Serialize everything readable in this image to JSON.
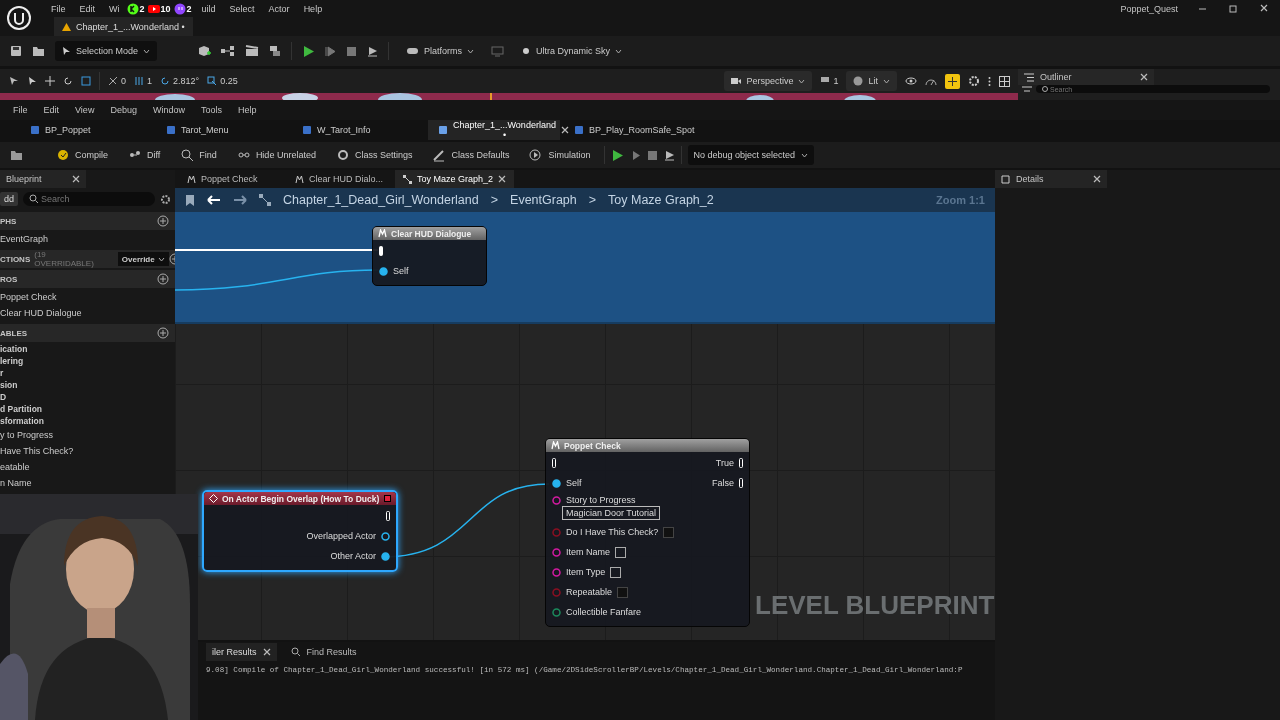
{
  "title_bar": {
    "menu": [
      "File",
      "Edit",
      "Wi",
      "uild",
      "Select",
      "Actor",
      "Help"
    ],
    "stream_badges": [
      {
        "kind": "kick",
        "count": "2"
      },
      {
        "kind": "youtube",
        "count": "10"
      },
      {
        "kind": "twitch",
        "count": "2"
      }
    ],
    "project": "Poppet_Quest",
    "level_tab": "Chapter_1_...Wonderland •"
  },
  "main_toolbar": {
    "mode": "Selection Mode",
    "platforms": "Platforms",
    "sky": "Ultra Dynamic Sky"
  },
  "viewport_toolbar": {
    "values": [
      "0",
      "1",
      "2.812°",
      "0.25"
    ],
    "perspective": "Perspective",
    "view_count": "1",
    "lit": "Lit"
  },
  "outliner": {
    "title": "Outliner",
    "search_placeholder": "Search"
  },
  "blueprint_menu": [
    "File",
    "Edit",
    "View",
    "Debug",
    "Window",
    "Tools",
    "Help"
  ],
  "doc_tabs": [
    {
      "label": "BP_Poppet",
      "selected": false
    },
    {
      "label": "Tarot_Menu",
      "selected": false
    },
    {
      "label": "W_Tarot_Info",
      "selected": false
    },
    {
      "label": "Chapter_1_...Wonderland •",
      "selected": true
    },
    {
      "label": "BP_Play_RoomSafe_Spot",
      "selected": false
    }
  ],
  "bp_toolbar": {
    "buttons": [
      {
        "kind": "compile",
        "label": "Compile"
      },
      {
        "kind": "diff",
        "label": "Diff"
      },
      {
        "kind": "find",
        "label": "Find"
      },
      {
        "kind": "hide",
        "label": "Hide Unrelated"
      },
      {
        "kind": "settings",
        "label": "Class Settings"
      },
      {
        "kind": "defaults",
        "label": "Class Defaults"
      },
      {
        "kind": "simulation",
        "label": "Simulation"
      }
    ],
    "debug": "No debug object selected"
  },
  "my_blueprint": {
    "tab": "Blueprint",
    "add": "dd",
    "search_placeholder": "Search",
    "sections": [
      {
        "title": "PHS",
        "items": [
          {
            "kind": "entry",
            "label": "EventGraph"
          }
        ]
      },
      {
        "title": "CTIONS",
        "note": "(19 OVERRIDABLE)",
        "override": "Override"
      },
      {
        "title": "ROS",
        "items": [
          {
            "kind": "entry",
            "label": "Poppet Check"
          },
          {
            "kind": "entry",
            "label": "Clear HUD Dialogue"
          }
        ]
      },
      {
        "title": "ABLES",
        "items": [
          {
            "kind": "category",
            "label": "ication"
          },
          {
            "kind": "category",
            "label": "lering"
          },
          {
            "kind": "category",
            "label": "r"
          },
          {
            "kind": "category",
            "label": "sion"
          },
          {
            "kind": "category",
            "label": "D"
          },
          {
            "kind": "category",
            "label": "d Partition"
          },
          {
            "kind": "category",
            "label": "sformation"
          },
          {
            "kind": "entry",
            "label": "y to Progress"
          },
          {
            "kind": "entry",
            "label": "Have This Check?"
          },
          {
            "kind": "entry",
            "label": "eatable"
          },
          {
            "kind": "entry",
            "label": "n Name"
          }
        ]
      }
    ]
  },
  "graph": {
    "tabs": [
      {
        "label": "Poppet Check",
        "selected": false
      },
      {
        "label": "Clear HUD Dialo...",
        "selected": false
      },
      {
        "label": "Toy Maze Graph_2",
        "selected": true
      }
    ],
    "breadcrumb": [
      "Chapter_1_Dead_Girl_Wonderland",
      "EventGraph",
      "Toy Maze Graph_2"
    ],
    "breadcrumb_separator": ">",
    "zoom": "Zoom 1:1",
    "watermark": "LEVEL BLUEPRINT",
    "nodes": [
      {
        "kind": "macro",
        "title": "Clear HUD Dialogue",
        "selected": false,
        "inputs": [
          {
            "kind": "exec",
            "connected": true
          },
          {
            "label": "Self",
            "kind": "object",
            "connected": true
          }
        ]
      },
      {
        "kind": "event",
        "title": "On Actor Begin Overlap (How To Duck)",
        "selected": true,
        "outputs": [
          {
            "kind": "exec",
            "connected": false
          },
          {
            "label": "Overlapped Actor",
            "kind": "object",
            "connected": false
          },
          {
            "label": "Other Actor",
            "kind": "object",
            "connected": true
          }
        ]
      },
      {
        "kind": "macro",
        "title": "Poppet Check",
        "selected": false,
        "inputs": [
          {
            "kind": "exec",
            "connected": false
          },
          {
            "label": "Self",
            "kind": "object",
            "connected": true
          },
          {
            "label": "Story to Progress",
            "kind": "string",
            "connected": false,
            "value": "Magician Door Tutorial"
          },
          {
            "label": "Do I Have This Check?",
            "kind": "bool",
            "connected": false
          },
          {
            "label": "Item Name",
            "kind": "string",
            "connected": false
          },
          {
            "label": "Item Type",
            "kind": "string",
            "connected": false
          },
          {
            "label": "Repeatable",
            "kind": "bool",
            "connected": false
          },
          {
            "label": "Collectible Fanfare",
            "kind": "struct",
            "connected": false
          }
        ],
        "outputs": [
          {
            "label": "True",
            "kind": "exec",
            "connected": false
          },
          {
            "label": "False",
            "kind": "exec",
            "connected": false
          }
        ]
      }
    ]
  },
  "details": {
    "title": "Details"
  },
  "output_log": {
    "tabs": [
      {
        "label": "iler Results",
        "selected": true
      },
      {
        "label": "Find Results",
        "selected": false
      }
    ],
    "lines": [
      "9.08] Compile of Chapter_1_Dead_Girl_Wonderland successful! [in 572 ms] (/Game/2DSideScrollerBP/Levels/Chapter_1_Dead_Girl_Wonderland.Chapter_1_Dead_Girl_Wonderland:P"
    ]
  }
}
